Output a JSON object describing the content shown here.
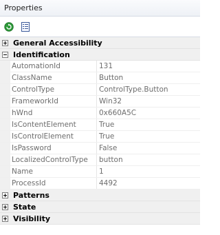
{
  "window": {
    "title": "Properties"
  },
  "toolbar": {
    "buttons": [
      {
        "icon": "refresh-icon"
      },
      {
        "icon": "property-pages-icon"
      }
    ]
  },
  "categories": [
    {
      "name": "General Accessibility",
      "expanded": false
    },
    {
      "name": "Identification",
      "expanded": true,
      "properties": [
        {
          "name": "AutomationId",
          "value": "131"
        },
        {
          "name": "ClassName",
          "value": "Button"
        },
        {
          "name": "ControlType",
          "value": "ControlType.Button"
        },
        {
          "name": "FrameworkId",
          "value": "Win32"
        },
        {
          "name": "hWnd",
          "value": "0x660A5C"
        },
        {
          "name": "IsContentElement",
          "value": "True"
        },
        {
          "name": "IsControlElement",
          "value": "True"
        },
        {
          "name": "IsPassword",
          "value": "False"
        },
        {
          "name": "LocalizedControlType",
          "value": "button"
        },
        {
          "name": "Name",
          "value": "1"
        },
        {
          "name": "ProcessId",
          "value": "4492"
        }
      ]
    },
    {
      "name": "Patterns",
      "expanded": false
    },
    {
      "name": "State",
      "expanded": false
    },
    {
      "name": "Visibility",
      "expanded": false
    }
  ],
  "colors": {
    "category_background": "#f0f0f0",
    "property_text": "#6d6d6d",
    "refresh_icon": "#2e9a3a"
  }
}
